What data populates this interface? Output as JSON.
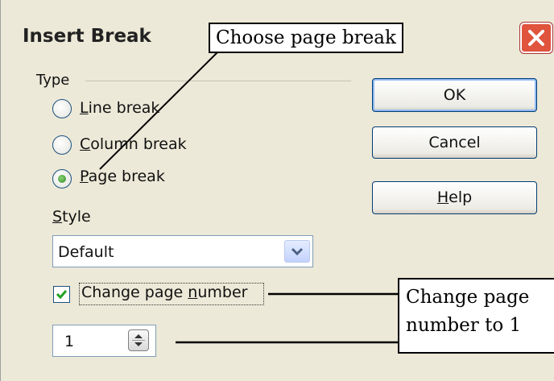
{
  "dialog": {
    "title": "Insert Break",
    "close_icon": "close-x-icon"
  },
  "type_group": {
    "label": "Type",
    "options": [
      {
        "label_accel": "L",
        "label_rest": "ine break",
        "selected": false
      },
      {
        "label_accel": "C",
        "label_rest": "olumn break",
        "selected": false
      },
      {
        "label_accel": "P",
        "label_rest": "age break",
        "selected": true
      }
    ]
  },
  "style": {
    "label_accel": "S",
    "label_rest": "tyle",
    "value": "Default"
  },
  "change_page_number": {
    "checked": true,
    "label_pre": "Change page ",
    "label_accel": "n",
    "label_post": "umber"
  },
  "page_number": {
    "value": "1"
  },
  "buttons": {
    "ok": "OK",
    "cancel": "Cancel",
    "help_accel": "H",
    "help_rest": "elp"
  },
  "callouts": {
    "top": "Choose page break",
    "right_line1": "Change page",
    "right_line2": "number to 1"
  },
  "colors": {
    "dialog_bg": "#ece9d8",
    "close_button": "#e0533c",
    "button_border": "#003c74",
    "radio_selected": "#2a8b1e"
  }
}
